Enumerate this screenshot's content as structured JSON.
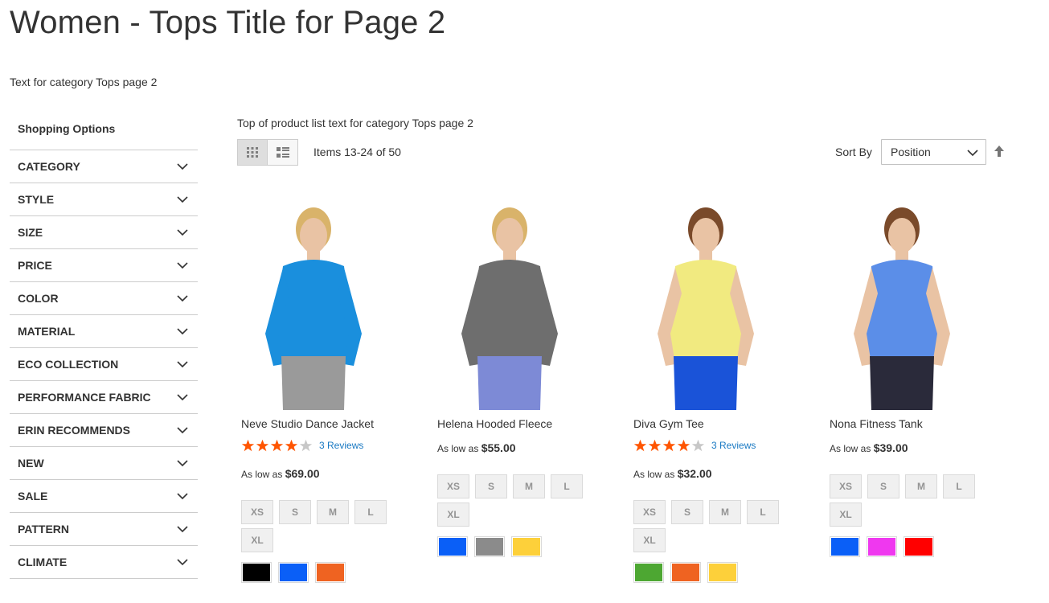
{
  "page": {
    "title": "Women - Tops Title for Page 2",
    "category_description": "Text for category Tops page 2"
  },
  "sidebar": {
    "title": "Shopping Options",
    "filters": [
      "CATEGORY",
      "STYLE",
      "SIZE",
      "PRICE",
      "COLOR",
      "MATERIAL",
      "ECO COLLECTION",
      "PERFORMANCE FABRIC",
      "ERIN RECOMMENDS",
      "NEW",
      "SALE",
      "PATTERN",
      "CLIMATE"
    ]
  },
  "toolbar": {
    "list_top_text": "Top of product list text for category Tops page 2",
    "view_modes": [
      "grid-icon",
      "list-icon"
    ],
    "amount": "Items 13-24 of 50",
    "sort_label": "Sort By",
    "sort_value": "Position",
    "sort_direction_icon": "arrow-up-icon"
  },
  "products": [
    {
      "name": "Neve Studio Dance Jacket",
      "rating_percent": 80,
      "reviews": "3  Reviews",
      "price_prefix": "As low as",
      "price": "$69.00",
      "sizes": [
        "XS",
        "S",
        "M",
        "L",
        "XL"
      ],
      "colors": [
        "#000000",
        "#0a5ff7",
        "#ef6321"
      ],
      "image_color": "#1a8fdd"
    },
    {
      "name": "Helena Hooded Fleece",
      "rating_percent": null,
      "reviews": "",
      "price_prefix": "As low as",
      "price": "$55.00",
      "sizes": [
        "XS",
        "S",
        "M",
        "L",
        "XL"
      ],
      "colors": [
        "#0a5ff7",
        "#8b8b8b",
        "#fdd03a"
      ],
      "image_color": "#6e6e6e"
    },
    {
      "name": "Diva Gym Tee",
      "rating_percent": 80,
      "reviews": "3  Reviews",
      "price_prefix": "As low as",
      "price": "$32.00",
      "sizes": [
        "XS",
        "S",
        "M",
        "L",
        "XL"
      ],
      "colors": [
        "#4da732",
        "#ef6321",
        "#fdd03a"
      ],
      "image_color": "#f1ea80"
    },
    {
      "name": "Nona Fitness Tank",
      "rating_percent": null,
      "reviews": "",
      "price_prefix": "As low as",
      "price": "$39.00",
      "sizes": [
        "XS",
        "S",
        "M",
        "L",
        "XL"
      ],
      "colors": [
        "#0a5ff7",
        "#ef38ef",
        "#ff0000"
      ],
      "image_color": "#5b8ee8"
    }
  ],
  "colors": {
    "star_filled": "#ff5501",
    "star_empty": "#c7c7c7",
    "link": "#1979c3"
  }
}
